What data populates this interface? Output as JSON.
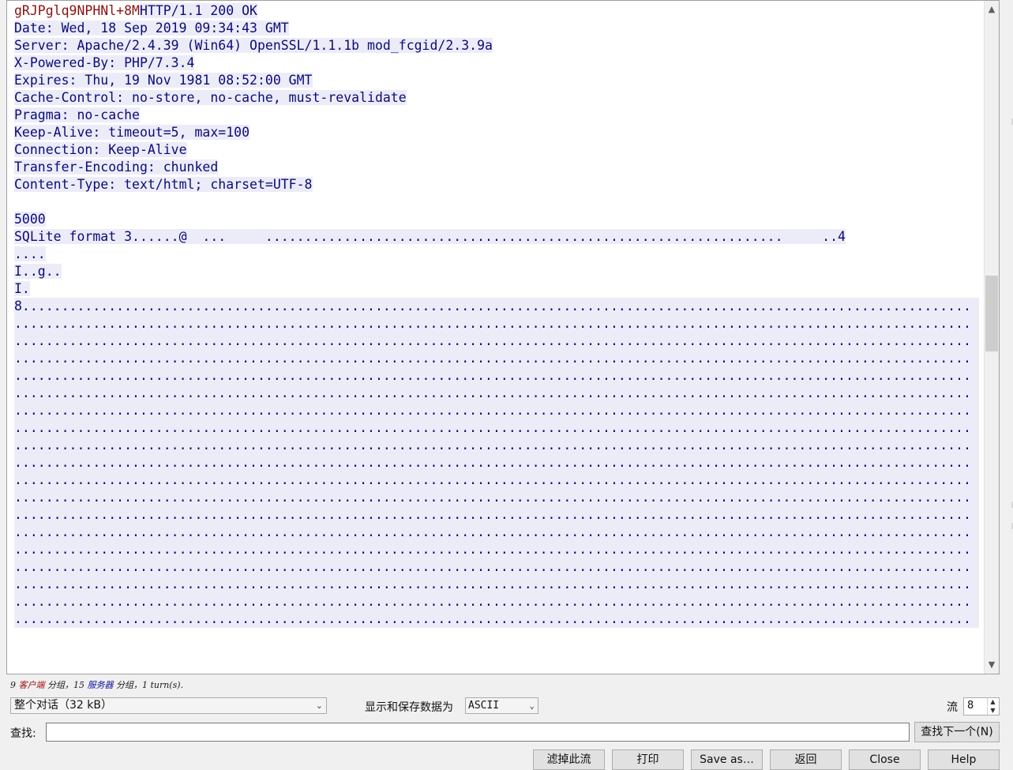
{
  "stream": {
    "client_prefix": "gRJPglq9NPHNl+8M",
    "lines": [
      "HTTP/1.1 200 OK",
      "Date: Wed, 18 Sep 2019 09:34:43 GMT",
      "Server: Apache/2.4.39 (Win64) OpenSSL/1.1.1b mod_fcgid/2.3.9a",
      "X-Powered-By: PHP/7.3.4",
      "Expires: Thu, 19 Nov 1981 08:52:00 GMT",
      "Cache-Control: no-store, no-cache, must-revalidate",
      "Pragma: no-cache",
      "Keep-Alive: timeout=5, max=100",
      "Connection: Keep-Alive",
      "Transfer-Encoding: chunked",
      "Content-Type: text/html; charset=UTF-8",
      "",
      "5000",
      "SQLite format 3......@  ...     ..................................................................     ..4",
      "....",
      "I..g..",
      "I.",
      "8.........................................................................................................................",
      "..........................................................................................................................",
      "..........................................................................................................................",
      "..........................................................................................................................",
      "..........................................................................................................................",
      "..........................................................................................................................",
      "..........................................................................................................................",
      "..........................................................................................................................",
      "..........................................................................................................................",
      "..........................................................................................................................",
      "..........................................................................................................................",
      "..........................................................................................................................",
      "..........................................................................................................................",
      "..........................................................................................................................",
      "..........................................................................................................................",
      "..........................................................................................................................",
      "..........................................................................................................................",
      "..........................................................................................................................",
      ".........................................................................................................................."
    ]
  },
  "status": {
    "client_count": "9",
    "client_word": "客户端",
    "sep1": " 分组，",
    "server_count": "15",
    "server_word": "服务器",
    "sep2": " 分组，",
    "turns": "1 turn(s)."
  },
  "controls": {
    "conversation_select": "整个对话（32 kB）",
    "show_save_label": "显示和保存数据为",
    "format_select": "ASCII",
    "stream_label": "流",
    "stream_value": "8",
    "find_label": "查找:",
    "find_value": "",
    "find_next_label": "查找下一个(N)"
  },
  "buttons": {
    "filter_out": "滤掉此流",
    "print": "打印",
    "save_as": "Save as…",
    "back": "返回",
    "close": "Close",
    "help": "Help"
  },
  "colors": {
    "client_text": "#8b1010",
    "server_text": "#0b0b78",
    "server_bg": "#ececf9"
  }
}
